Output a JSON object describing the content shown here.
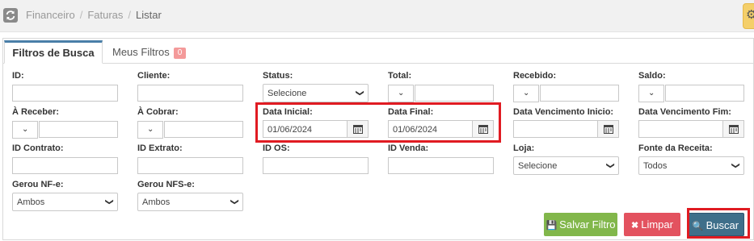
{
  "breadcrumb": {
    "items": [
      "Financeiro",
      "Faturas",
      "Listar"
    ]
  },
  "tabs": [
    {
      "label": "Filtros de Busca"
    },
    {
      "label": "Meus Filtros",
      "badge": "0"
    }
  ],
  "filters": {
    "id": {
      "label": "ID:",
      "value": ""
    },
    "cliente": {
      "label": "Cliente:",
      "value": ""
    },
    "status": {
      "label": "Status:",
      "value": "Selecione"
    },
    "total": {
      "label": "Total:",
      "value": ""
    },
    "recebido": {
      "label": "Recebido:",
      "value": ""
    },
    "saldo": {
      "label": "Saldo:",
      "value": ""
    },
    "a_receber": {
      "label": "À Receber:",
      "value": ""
    },
    "a_cobrar": {
      "label": "À Cobrar:",
      "value": ""
    },
    "data_inicial": {
      "label": "Data Inicial:",
      "value": "01/06/2024"
    },
    "data_final": {
      "label": "Data Final:",
      "value": "01/06/2024"
    },
    "data_venc_inicio": {
      "label": "Data Vencimento Inicio:",
      "value": ""
    },
    "data_venc_fim": {
      "label": "Data Vencimento Fim:",
      "value": ""
    },
    "id_contrato": {
      "label": "ID Contrato:",
      "value": ""
    },
    "id_extrato": {
      "label": "ID Extrato:",
      "value": ""
    },
    "id_os": {
      "label": "ID OS:",
      "value": ""
    },
    "id_venda": {
      "label": "ID Venda:",
      "value": ""
    },
    "loja": {
      "label": "Loja:",
      "value": "Selecione"
    },
    "fonte_receita": {
      "label": "Fonte da Receita:",
      "value": "Todos"
    },
    "gerou_nfe": {
      "label": "Gerou NF-e:",
      "value": "Ambos"
    },
    "gerou_nfse": {
      "label": "Gerou NFS-e:",
      "value": "Ambos"
    }
  },
  "buttons": {
    "save": "Salvar Filtro",
    "clear": "Limpar",
    "search": "Buscar"
  },
  "colors": {
    "save": "#82b74b",
    "clear": "#e3525f",
    "search": "#3f6f8a",
    "highlight": "#e01b22"
  }
}
